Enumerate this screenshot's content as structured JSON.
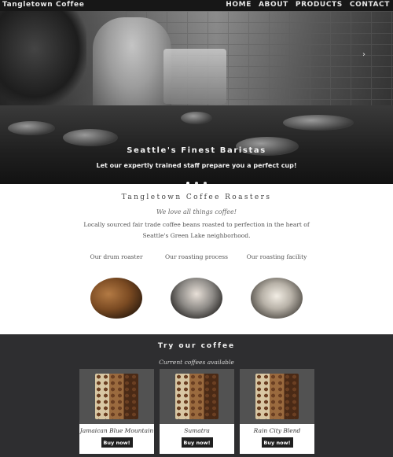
{
  "nav": {
    "brand": "Tangletown Coffee",
    "items": [
      {
        "label": "HOME"
      },
      {
        "label": "ABOUT"
      },
      {
        "label": "PRODUCTS"
      },
      {
        "label": "CONTACT"
      }
    ]
  },
  "hero": {
    "title": "Seattle's Finest Baristas",
    "subtitle": "Let our expertly trained staff prepare you a perfect cup!",
    "next_arrow": "›"
  },
  "about": {
    "title": "Tangletown Coffee Roasters",
    "tagline": "We love all things coffee!",
    "description": "Locally sourced fair trade coffee beans roasted to perfection in the heart of Seattle's Green Lake neighborhood.",
    "features": [
      {
        "label": "Our drum roaster"
      },
      {
        "label": "Our roasting process"
      },
      {
        "label": "Our roasting facility"
      }
    ]
  },
  "coffees": {
    "title": "Try our coffee",
    "subtitle": "Current coffees available",
    "items": [
      {
        "name": "Jamaican Blue Mountain",
        "button": "Buy now!"
      },
      {
        "name": "Sumatra",
        "button": "Buy now!"
      },
      {
        "name": "Rain City Blend",
        "button": "Buy now!"
      }
    ]
  }
}
